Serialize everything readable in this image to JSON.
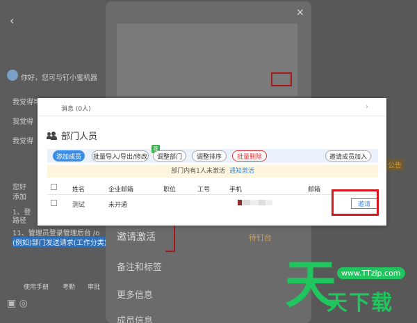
{
  "background": {
    "greeting": "你好，您可与钉小蜜机器",
    "lines": [
      "我觉得可以做到(必填)",
      "我觉得",
      "我觉得",
      "您好",
      "添加",
      "1、登",
      "路径",
      "11、管理员登录管理后台 /o",
      "(例如)部门发送请求(工作分类)..."
    ],
    "tools": [
      "使用手册",
      "考勤",
      "审批"
    ],
    "right_tag": "公告"
  },
  "side_panel": {
    "close": "×",
    "items": [
      "邀请激活",
      "备注和标签",
      "更多信息",
      "成员信息"
    ],
    "tag": "待钉台"
  },
  "card": {
    "notify_label": "消息  (0人)",
    "section_title": "部门人员",
    "toolbar": {
      "add": "添加成员",
      "import": "批量导入/导出/修改",
      "new_badge": "荐",
      "adjust_dept": "调整部门",
      "adjust_order": "调整排序",
      "batch_delete": "批量删除",
      "invite_join": "邀请成员加入"
    },
    "notice": {
      "text": "部门内有1人未激活",
      "link": "通知激活"
    },
    "columns": [
      "姓名",
      "企业邮箱",
      "职位",
      "工号",
      "手机",
      "邮箱"
    ],
    "rows": [
      {
        "name": "测试",
        "email": "未开通",
        "position": "",
        "number": "",
        "phone": "",
        "mail": "",
        "action": "邀请"
      }
    ]
  },
  "watermark": {
    "big": "天",
    "url": "www.TTzip.com",
    "text": "天下载"
  }
}
